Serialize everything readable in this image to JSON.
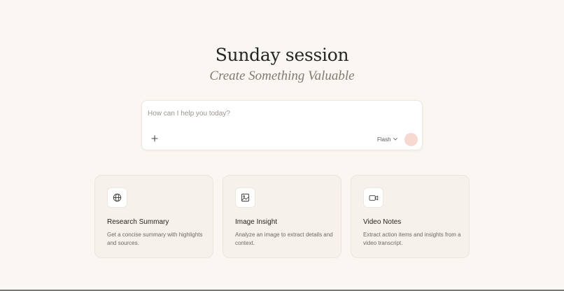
{
  "hero": {
    "title": "Sunday session",
    "subtitle": "Create Something Valuable"
  },
  "composer": {
    "placeholder": "How can I help you today?",
    "value": "",
    "attach_icon": "plus-icon",
    "model_label": "Flash",
    "model_icon": "chevron-down-icon",
    "send_icon": "send-button",
    "send_color": "#f7d9d2"
  },
  "cards": [
    {
      "icon": "globe-icon",
      "title": "Research Summary",
      "description": "Get a concise summary with highlights and sources."
    },
    {
      "icon": "image-icon",
      "title": "Image Insight",
      "description": "Analyze an image to extract details and context."
    },
    {
      "icon": "video-icon",
      "title": "Video Notes",
      "description": "Extract action items and insights from a video transcript."
    }
  ],
  "colors": {
    "background": "#faf7f2",
    "card_background": "#f6f2eb",
    "title_text": "#262523",
    "subtitle_text": "#7f7b74"
  }
}
